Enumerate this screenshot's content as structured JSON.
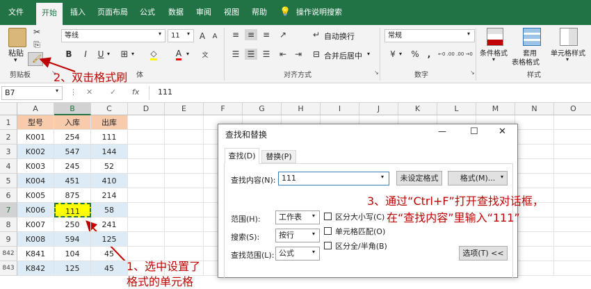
{
  "tabs": [
    "文件",
    "开始",
    "插入",
    "页面布局",
    "公式",
    "数据",
    "审阅",
    "视图",
    "帮助"
  ],
  "tell_me": "操作说明搜索",
  "ribbon": {
    "paste": "粘贴",
    "clipboard_group": "剪贴板",
    "font_name": "等线",
    "font_size": "11",
    "font_group": "体",
    "wrap_text": "自动换行",
    "merge_center": "合并后居中",
    "align_group": "对齐方式",
    "number_format": "常规",
    "number_group": "数字",
    "cond_format": "条件格式",
    "table_format_1": "套用",
    "table_format_2": "表格格式",
    "cell_styles": "单元格样式",
    "styles_group": "样式",
    "bold": "B",
    "italic": "I",
    "underline": "U",
    "font_color": "A",
    "grow": "A",
    "shrink": "A",
    "pct": "%",
    "comma": ",",
    "inc_dec": "←0 .00",
    "dec_dec": ".00 →0"
  },
  "formula_bar": {
    "name_box": "B7",
    "value": "111",
    "fx": "fx"
  },
  "columns": [
    "A",
    "B",
    "C",
    "D",
    "E",
    "F",
    "G",
    "H",
    "I",
    "J",
    "K",
    "L",
    "M",
    "N",
    "O"
  ],
  "rows": [
    {
      "n": "1",
      "a": "型号",
      "b": "入库",
      "c": "出库"
    },
    {
      "n": "2",
      "a": "K001",
      "b": "254",
      "c": "111"
    },
    {
      "n": "3",
      "a": "K002",
      "b": "547",
      "c": "144"
    },
    {
      "n": "4",
      "a": "K003",
      "b": "245",
      "c": "52"
    },
    {
      "n": "5",
      "a": "K004",
      "b": "451",
      "c": "410"
    },
    {
      "n": "6",
      "a": "K005",
      "b": "875",
      "c": "214"
    },
    {
      "n": "7",
      "a": "K006",
      "b": "111",
      "c": "58"
    },
    {
      "n": "8",
      "a": "K007",
      "b": "250",
      "c": "241"
    },
    {
      "n": "9",
      "a": "K008",
      "b": "594",
      "c": "125"
    },
    {
      "n": "842",
      "a": "K841",
      "b": "104",
      "c": "45"
    },
    {
      "n": "843",
      "a": "K842",
      "b": "125",
      "c": "45"
    }
  ],
  "annotations": {
    "step2": "2、双击格式刷",
    "step3_line1": "3、通过“Ctrl+F”打开查找对话框，",
    "step3_line2": "在“查找内容”里输入“111”",
    "step1_line1": "1、选中设置了",
    "step1_line2": "格式的单元格"
  },
  "dialog": {
    "title": "查找和替换",
    "tab_find": "查找(D)",
    "tab_replace": "替换(P)",
    "find_label": "查找内容(N):",
    "find_value": "111",
    "no_format": "未设定格式",
    "format_btn": "格式(M)...",
    "within_label": "范围(H):",
    "within_value": "工作表",
    "search_label": "搜索(S):",
    "search_value": "按行",
    "lookin_label": "查找范围(L):",
    "lookin_value": "公式",
    "match_case": "区分大小写(C)",
    "match_cell": "单元格匹配(O)",
    "match_width": "区分全/半角(B)",
    "options_btn": "选项(T) <<",
    "minimize": "—",
    "maximize": "☐",
    "close": "✕"
  },
  "colors": {
    "accent": "#217346",
    "annot": "#c00000",
    "header_fill": "#f8cbad",
    "band_fill": "#ddebf7",
    "highlight": "#ffff00"
  }
}
